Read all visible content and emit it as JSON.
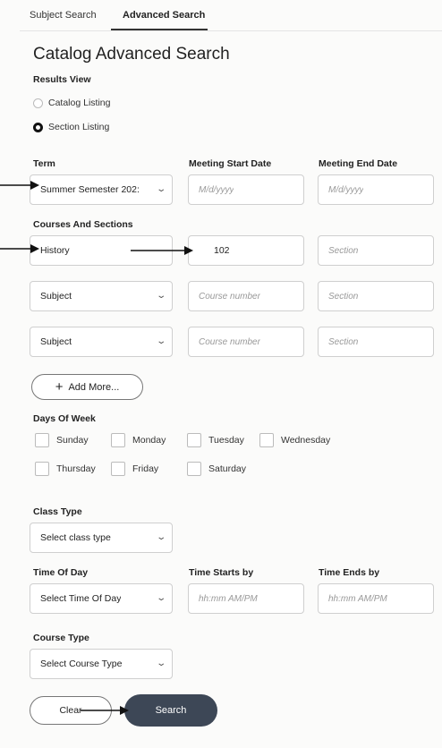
{
  "tabs": [
    {
      "label": "Subject Search",
      "active": false
    },
    {
      "label": "Advanced Search",
      "active": true
    }
  ],
  "page_title": "Catalog Advanced Search",
  "results_view": {
    "label": "Results View",
    "options": [
      {
        "label": "Catalog Listing",
        "selected": false
      },
      {
        "label": "Section Listing",
        "selected": true
      }
    ]
  },
  "term": {
    "label": "Term",
    "value": "Summer Semester 202:"
  },
  "meeting_start_date": {
    "label": "Meeting Start Date",
    "placeholder": "M/d/yyyy"
  },
  "meeting_end_date": {
    "label": "Meeting End Date",
    "placeholder": "M/d/yyyy"
  },
  "courses_and_sections": {
    "label": "Courses And Sections",
    "rows": [
      {
        "subject": "History",
        "course_number": "102",
        "section_placeholder": "Section"
      },
      {
        "subject": "Subject",
        "course_number_placeholder": "Course number",
        "section_placeholder": "Section"
      },
      {
        "subject": "Subject",
        "course_number_placeholder": "Course number",
        "section_placeholder": "Section"
      }
    ]
  },
  "add_more_label": "Add More...",
  "days_of_week": {
    "label": "Days Of Week",
    "days": [
      "Sunday",
      "Monday",
      "Tuesday",
      "Wednesday",
      "Thursday",
      "Friday",
      "Saturday"
    ]
  },
  "class_type": {
    "label": "Class Type",
    "value": "Select class type"
  },
  "time_of_day": {
    "label": "Time Of Day",
    "value": "Select Time Of Day"
  },
  "time_starts_by": {
    "label": "Time Starts by",
    "placeholder": "hh:mm AM/PM"
  },
  "time_ends_by": {
    "label": "Time Ends by",
    "placeholder": "hh:mm AM/PM"
  },
  "course_type": {
    "label": "Course Type",
    "value": "Select Course Type"
  },
  "buttons": {
    "clear": "Clear",
    "search": "Search"
  },
  "icons": {
    "plus": "plus-icon",
    "chevron": "chevron-down-icon",
    "arrow": "arrow-right-icon"
  },
  "colors": {
    "search_button": "#3d4756",
    "annotation_arrow": "#111111"
  }
}
